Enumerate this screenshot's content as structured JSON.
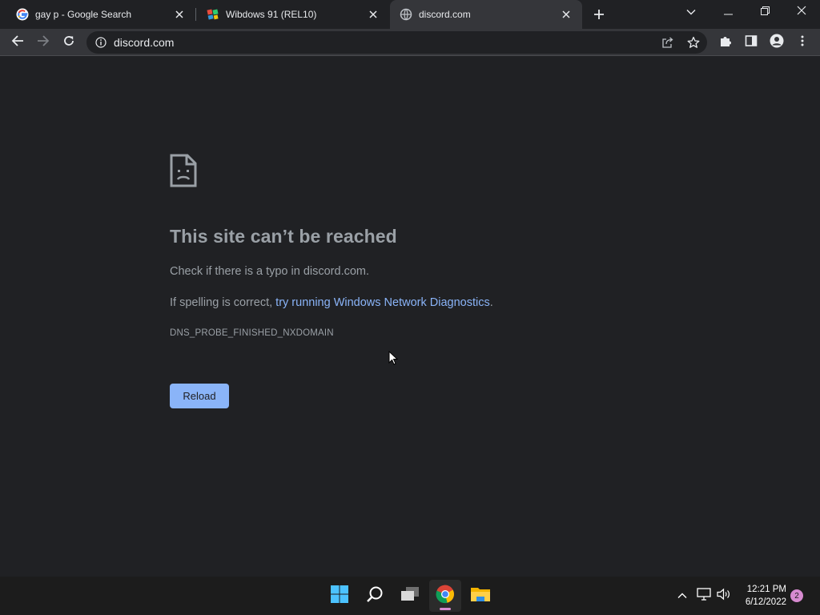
{
  "browser": {
    "tabs": [
      {
        "title": "gay p - Google Search",
        "favicon": "google-g-icon",
        "active": false
      },
      {
        "title": "Wibdows 91 (REL10)",
        "favicon": "colorful-app-icon",
        "active": false
      },
      {
        "title": "discord.com",
        "favicon": "globe-icon",
        "active": true
      }
    ],
    "address": "discord.com"
  },
  "error_page": {
    "headline": "This site can’t be reached",
    "message_prefix": "Check if there is a typo in ",
    "message_domain": "discord.com",
    "message_suffix": ".",
    "suggestion_prefix": "If spelling is correct, ",
    "suggestion_link": "try running Windows Network Diagnostics",
    "suggestion_suffix": ".",
    "error_code": "DNS_PROBE_FINISHED_NXDOMAIN",
    "reload_label": "Reload"
  },
  "taskbar": {
    "time": "12:21 PM",
    "date": "6/12/2022",
    "notification_count": "2"
  },
  "colors": {
    "page_bg": "#202124",
    "toolbar_bg": "#35363a",
    "link": "#8ab4f8",
    "reload_button": "#8ab4f8",
    "notification_badge": "#d78bd0"
  }
}
